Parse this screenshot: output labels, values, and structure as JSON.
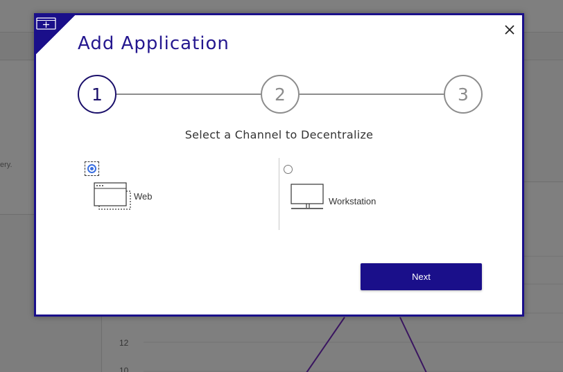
{
  "modal": {
    "title": "Add Application",
    "close_icon": "close-icon",
    "corner_icon": "add-window-icon",
    "steps": [
      "1",
      "2",
      "3"
    ],
    "active_step": 1,
    "subtitle": "Select a Channel to Decentralize",
    "options": [
      {
        "label": "Web",
        "icon": "browser-window-icon",
        "selected": true
      },
      {
        "label": "Workstation",
        "icon": "monitor-icon",
        "selected": false
      }
    ],
    "next_label": "Next"
  },
  "background": {
    "left_snippet": "ery.",
    "chart_ticks": [
      "12",
      "10"
    ]
  },
  "colors": {
    "brand": "#1a0f8a",
    "radio_selected": "#3a6fe0",
    "step_inactive": "#8c8c8c"
  }
}
